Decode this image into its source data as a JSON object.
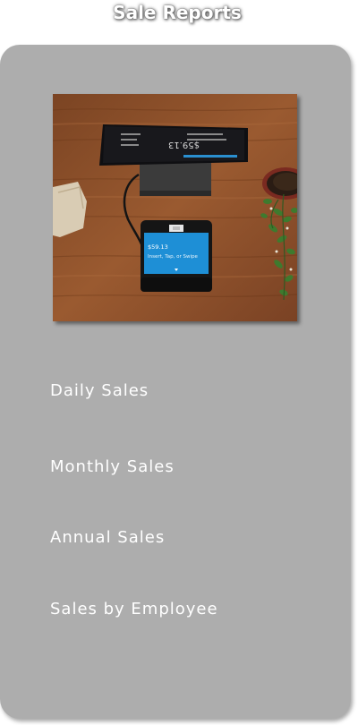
{
  "page": {
    "title": "Sale Reports"
  },
  "hero_image": {
    "kind": "photo",
    "subject": "point-of-sale terminal on wooden table",
    "screen_amount": "$59.13",
    "screen_prompt": "Insert, Tap, or Swipe",
    "top_screen_amount": "$59.13"
  },
  "menu": {
    "items": [
      {
        "label": "Daily Sales"
      },
      {
        "label": "Monthly Sales"
      },
      {
        "label": "Annual Sales"
      },
      {
        "label": "Sales by Employee"
      }
    ]
  },
  "colors": {
    "panel": "#adadad",
    "title_text": "#ffffff",
    "menu_text": "#ffffff",
    "terminal_screen": "#1e8fd6",
    "wood": "#8a4f2a"
  }
}
